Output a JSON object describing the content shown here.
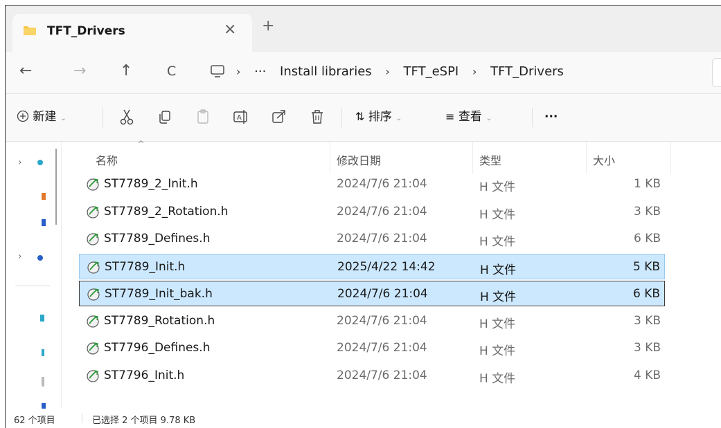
{
  "tab": {
    "title": "TFT_Drivers",
    "close": "×",
    "new_tab": "+"
  },
  "nav": {
    "back": "←",
    "forward": "→",
    "up": "↑",
    "refresh": "C",
    "crumb_more": "···",
    "crumb_sep": "›",
    "breadcrumbs": [
      "Install libraries",
      "TFT_eSPI",
      "TFT_Drivers"
    ]
  },
  "toolbar": {
    "new_label": "新建",
    "sort_label": "排序",
    "view_label": "查看",
    "more": "···",
    "chev": "⌄"
  },
  "columns": {
    "name": "名称",
    "modified": "修改日期",
    "type": "类型",
    "size": "大小"
  },
  "files": [
    {
      "name": "ST7789_2_Init.h",
      "modified": "2024/7/6 21:04",
      "type": "H 文件",
      "size": "1 KB",
      "state": "normal"
    },
    {
      "name": "ST7789_2_Rotation.h",
      "modified": "2024/7/6 21:04",
      "type": "H 文件",
      "size": "3 KB",
      "state": "normal"
    },
    {
      "name": "ST7789_Defines.h",
      "modified": "2024/7/6 21:04",
      "type": "H 文件",
      "size": "6 KB",
      "state": "normal"
    },
    {
      "name": "ST7789_Init.h",
      "modified": "2025/4/22 14:42",
      "type": "H 文件",
      "size": "5 KB",
      "state": "selected"
    },
    {
      "name": "ST7789_Init_bak.h",
      "modified": "2024/7/6 21:04",
      "type": "H 文件",
      "size": "6 KB",
      "state": "focused"
    },
    {
      "name": "ST7789_Rotation.h",
      "modified": "2024/7/6 21:04",
      "type": "H 文件",
      "size": "3 KB",
      "state": "normal"
    },
    {
      "name": "ST7796_Defines.h",
      "modified": "2024/7/6 21:04",
      "type": "H 文件",
      "size": "3 KB",
      "state": "normal"
    },
    {
      "name": "ST7796_Init.h",
      "modified": "2024/7/6 21:04",
      "type": "H 文件",
      "size": "4 KB",
      "state": "normal"
    }
  ],
  "status": {
    "count": "62 个项目",
    "selection": "已选择 2 个项目  9.78 KB"
  },
  "colors": {
    "selected_bg": "#cce8ff",
    "selected_border": "#99c9ee",
    "focus_border": "#3c3c3c",
    "folder": "#f4c542"
  }
}
